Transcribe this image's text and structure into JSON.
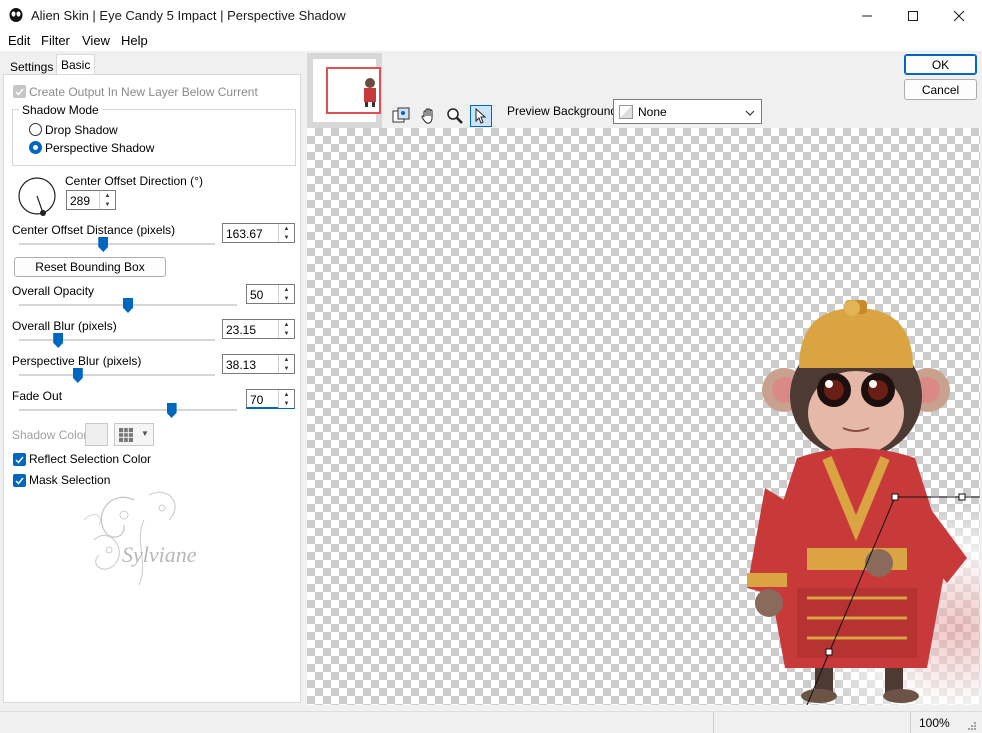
{
  "window": {
    "title": "Alien Skin | Eye Candy 5 Impact | Perspective Shadow"
  },
  "menu": [
    "Edit",
    "Filter",
    "View",
    "Help"
  ],
  "tabs": {
    "settings": "Settings",
    "basic": "Basic"
  },
  "controls": {
    "create_output": "Create Output In New Layer Below Current",
    "shadow_mode_title": "Shadow Mode",
    "drop_shadow": "Drop Shadow",
    "perspective_shadow": "Perspective Shadow",
    "center_offset_direction_label": "Center Offset Direction (°)",
    "center_offset_direction_value": "289",
    "center_offset_distance_label": "Center Offset Distance (pixels)",
    "center_offset_distance_value": "163.67",
    "center_offset_distance_level": 0.43,
    "reset_bounding_box": "Reset Bounding Box",
    "overall_opacity_label": "Overall Opacity",
    "overall_opacity_value": "50",
    "overall_opacity_level": 0.5,
    "overall_blur_label": "Overall Blur (pixels)",
    "overall_blur_value": "23.15",
    "overall_blur_level": 0.2,
    "perspective_blur_label": "Perspective Blur (pixels)",
    "perspective_blur_value": "38.13",
    "perspective_blur_level": 0.3,
    "fade_out_label": "Fade Out",
    "fade_out_value": "70",
    "fade_out_level": 0.7,
    "shadow_color_label": "Shadow Color",
    "reflect_selection_color": "Reflect Selection Color",
    "mask_selection": "Mask Selection"
  },
  "watermark": "Sylviane",
  "buttons": {
    "ok": "OK",
    "cancel": "Cancel"
  },
  "preview": {
    "background_label": "Preview Background:",
    "background_value": "None"
  },
  "status": {
    "zoom": "100%"
  },
  "colors": {
    "accent": "#0067c0",
    "thumb_highlight": "#e05050",
    "robe": "#c83a3a",
    "gold": "#d9a441"
  }
}
